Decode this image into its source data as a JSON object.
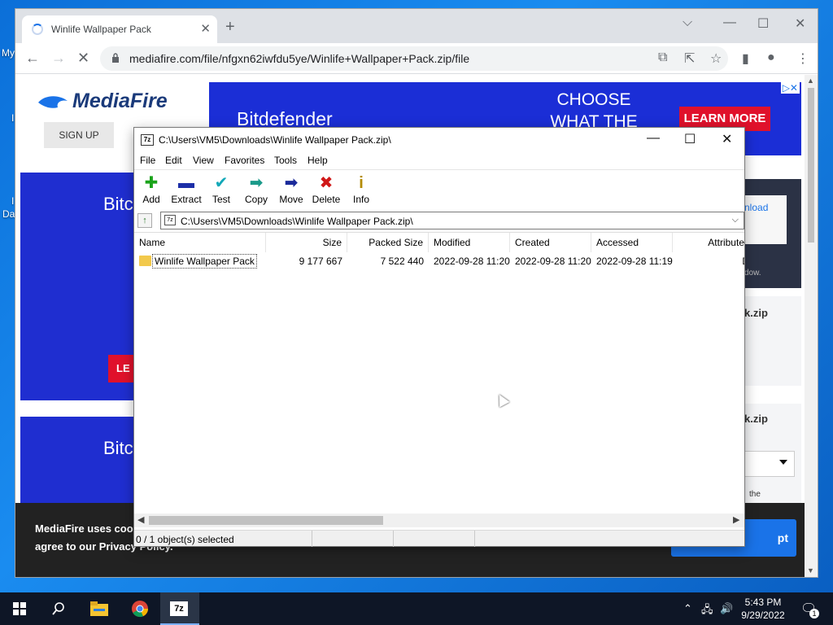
{
  "desktop": {
    "icon_labels": [
      "My",
      "I",
      "I",
      "Da"
    ]
  },
  "browser": {
    "tab_title": "Winlife Wallpaper Pack",
    "url": "mediafire.com/file/nfgxn62iwfdu5ye/Winlife+Wallpaper+Pack.zip/file",
    "icons": [
      "loading-spinner-icon",
      "close-icon",
      "plus-icon",
      "chevron-down-icon",
      "minimize-icon",
      "maximize-icon",
      "close-icon",
      "back-icon",
      "forward-icon",
      "stop-reload-icon",
      "lock-icon",
      "blocked-popup-icon",
      "share-icon",
      "star-icon",
      "sidebar-icon",
      "profile-icon",
      "kebab-menu-icon"
    ]
  },
  "page": {
    "logo": "MediaFire",
    "signup": "SIGN UP",
    "banner": {
      "brand": "Bitdefender",
      "headline": "CHOOSE WHAT THE EXPERTS",
      "cta": "LEARN MORE"
    },
    "side_ad_text": "Bitc",
    "side_ad_btn": "LE",
    "side_ad2_text": "Bitc",
    "right": {
      "download_link": "nload",
      "note": "dow.",
      "zip1": "k.zip",
      "zip2": "k.zip",
      "the": "the"
    },
    "cookie": {
      "line1": "MediaFire uses cook",
      "line2": "agree to our Privacy Policy.",
      "accept": "pt"
    }
  },
  "sevenzip": {
    "title": "C:\\Users\\VM5\\Downloads\\Winlife Wallpaper Pack.zip\\",
    "menu": [
      "File",
      "Edit",
      "View",
      "Favorites",
      "Tools",
      "Help"
    ],
    "toolbar": [
      {
        "label": "Add",
        "icon": "add-icon",
        "glyph": "✚",
        "color": "#1aa31a"
      },
      {
        "label": "Extract",
        "icon": "extract-icon",
        "glyph": "▬",
        "color": "#1d2fa8"
      },
      {
        "label": "Test",
        "icon": "test-icon",
        "glyph": "✔",
        "color": "#12a8b8"
      },
      {
        "label": "Copy",
        "icon": "copy-icon",
        "glyph": "➡",
        "color": "#1a9a8a"
      },
      {
        "label": "Move",
        "icon": "move-icon",
        "glyph": "➡",
        "color": "#1a2a9a"
      },
      {
        "label": "Delete",
        "icon": "delete-icon",
        "glyph": "✖",
        "color": "#d01818"
      },
      {
        "label": "Info",
        "icon": "info-icon",
        "glyph": "i",
        "color": "#b38b00"
      }
    ],
    "path": "C:\\Users\\VM5\\Downloads\\Winlife Wallpaper Pack.zip\\",
    "columns": [
      "Name",
      "Size",
      "Packed Size",
      "Modified",
      "Created",
      "Accessed",
      "Attributes"
    ],
    "rows": [
      {
        "name": "Winlife Wallpaper Pack",
        "size": "9 177 667",
        "packed": "7 522 440",
        "modified": "2022-09-28 11:20",
        "created": "2022-09-28 11:20",
        "accessed": "2022-09-28 11:19",
        "attributes": "D"
      }
    ],
    "status": "0 / 1 object(s) selected"
  },
  "taskbar": {
    "time": "5:43 PM",
    "date": "9/29/2022",
    "notif_count": "1",
    "app_icons": [
      "windows-start-icon",
      "search-icon",
      "file-explorer-icon",
      "chrome-icon",
      "7zip-icon"
    ]
  },
  "colors": {
    "accent": "#1a73e8",
    "bitdefender_blue": "#1b2ed6",
    "cta_red": "#e0112b",
    "taskbar": "#0e1626"
  }
}
